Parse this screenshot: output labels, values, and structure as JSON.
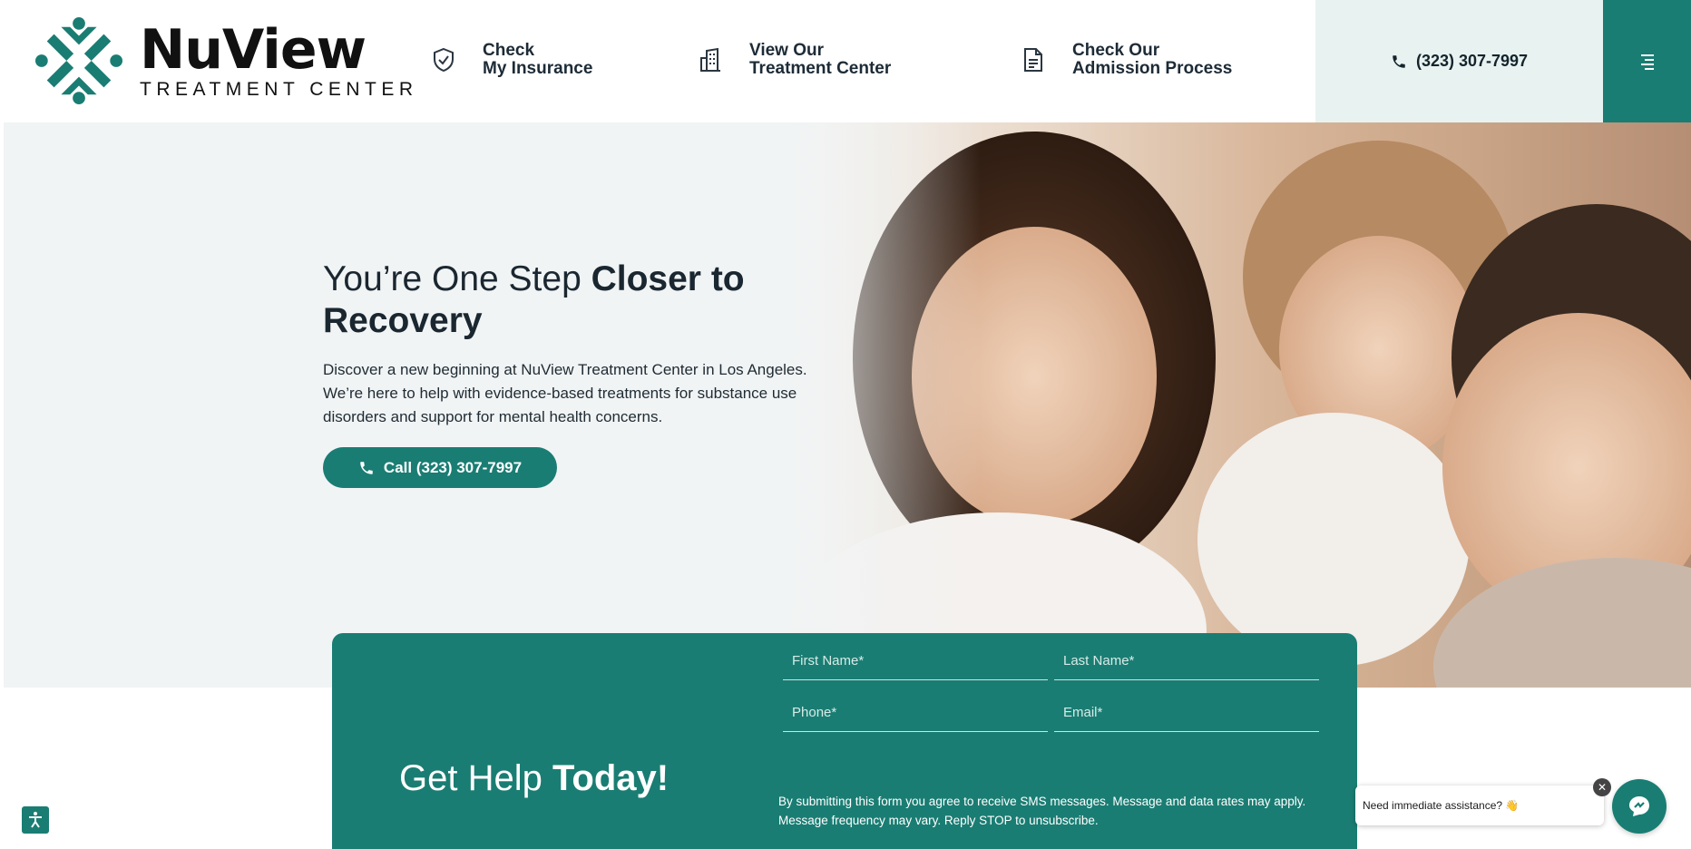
{
  "brand": {
    "name": "NuView",
    "subtitle": "TREATMENT CENTER",
    "accent_color": "#1a7d73"
  },
  "nav": {
    "insurance": {
      "line1": "Check",
      "line2": "My Insurance",
      "icon": "shield-check-icon"
    },
    "center": {
      "line1": "View Our",
      "line2": "Treatment Center",
      "icon": "building-icon"
    },
    "admission": {
      "line1": "Check Our",
      "line2": "Admission Process",
      "icon": "document-icon"
    },
    "phone": "(323) 307-7997",
    "menu_icon": "hamburger-menu-icon"
  },
  "hero": {
    "heading_regular": "You’re One Step ",
    "heading_bold": "Closer to Recovery",
    "description": "Discover a new beginning at NuView Treatment Center in Los Angeles. We’re here to help with evidence-based treatments for substance use disorders and support for mental health concerns.",
    "call_button": "Call (323) 307-7997"
  },
  "form": {
    "heading_regular": "Get Help ",
    "heading_bold": "Today!",
    "first_name_placeholder": "First Name*",
    "last_name_placeholder": "Last Name*",
    "phone_placeholder": "Phone*",
    "email_placeholder": "Email*",
    "sms_notice": "By submitting this form you agree to receive SMS messages. Message and data rates may apply. Message frequency may vary. Reply STOP to unsubscribe."
  },
  "chat": {
    "prompt": "Need immediate assistance? 👋",
    "close_label": "✕"
  }
}
